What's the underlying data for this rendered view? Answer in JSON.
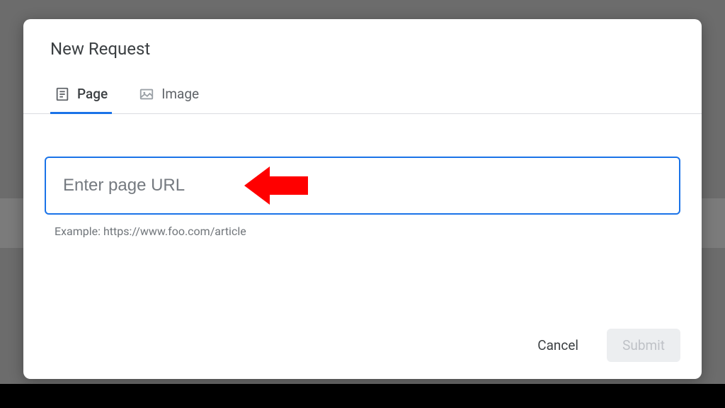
{
  "modal": {
    "title": "New Request",
    "tabs": [
      {
        "label": "Page",
        "active": true
      },
      {
        "label": "Image",
        "active": false
      }
    ],
    "input": {
      "placeholder": "Enter page URL",
      "value": ""
    },
    "example": "Example: https://www.foo.com/article",
    "actions": {
      "cancel": "Cancel",
      "submit": "Submit"
    }
  },
  "annotation": {
    "arrow_color": "#ff0000"
  }
}
